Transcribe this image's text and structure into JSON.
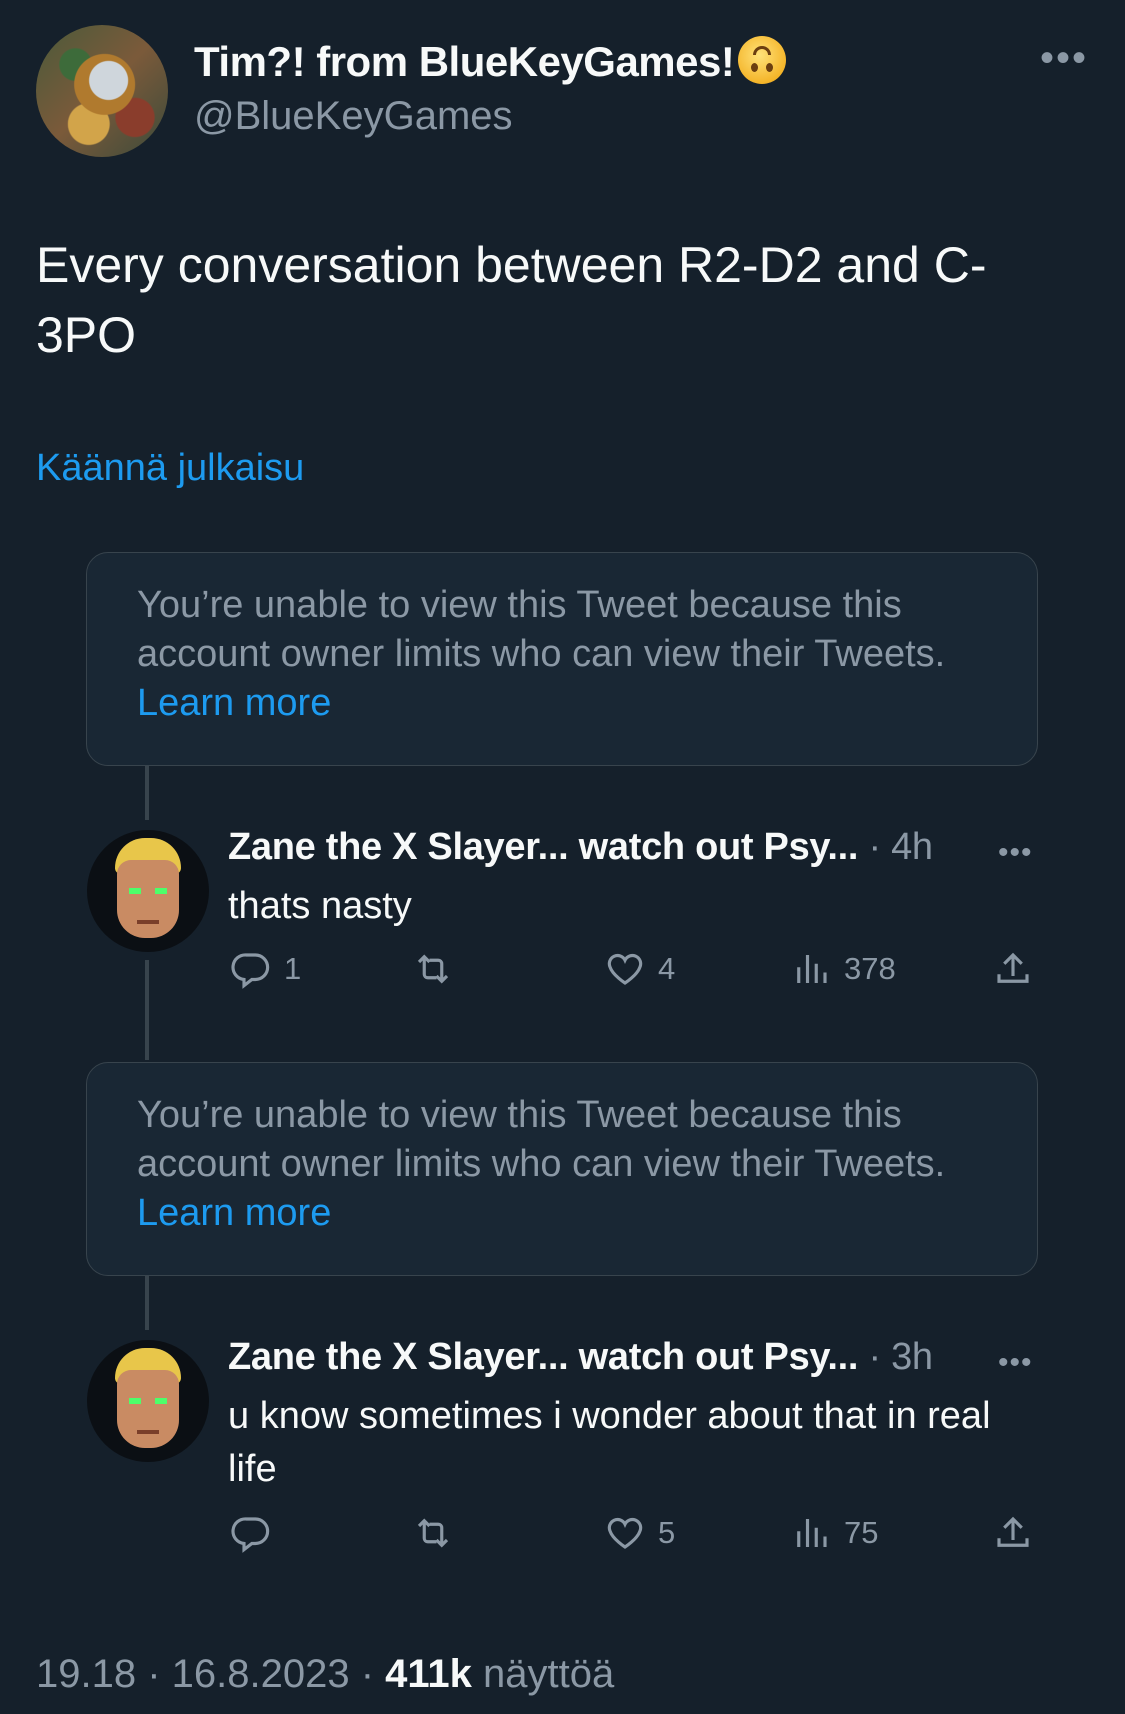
{
  "author": {
    "display_name": "Tim?! from BlueKeyGames!",
    "handle": "@BlueKeyGames",
    "emoji": "upside-down-face"
  },
  "tweet": {
    "text": "Every conversation between R2-D2 and C-3PO",
    "translate_label": "Käännä julkaisu"
  },
  "unavailable_notice": {
    "text": "You’re unable to view this Tweet because this account owner limits who can view their Tweets.",
    "link": "Learn more"
  },
  "replies": [
    {
      "name": "Zane the X Slayer... watch out Psy...",
      "time": "· 4h",
      "text": "thats nasty",
      "reply_count": "1",
      "retweet_count": "",
      "like_count": "4",
      "view_count": "378"
    },
    {
      "name": "Zane the X Slayer... watch out Psy...",
      "time": "· 3h",
      "text": "u know sometimes i wonder about that in real life",
      "reply_count": "",
      "retweet_count": "",
      "like_count": "5",
      "view_count": "75"
    }
  ],
  "footer": {
    "time": "19.18 · 16.8.2023 · ",
    "views": "411k",
    "views_label": " näyttöä"
  },
  "more_label": "•••",
  "colors": {
    "background": "#15202b",
    "accent": "#1d9bf0",
    "muted": "#8b98a5",
    "border": "#38444d"
  }
}
